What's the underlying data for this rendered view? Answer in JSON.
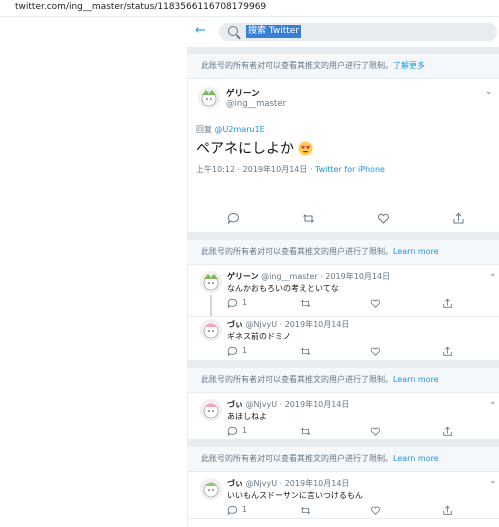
{
  "browser": {
    "url": "twitter.com/ing__master/status/1183566116708179969"
  },
  "header": {
    "search_placeholder": "搜索 Twitter"
  },
  "notice_top": {
    "text": "此账号的所有者对可以查看其推文的用户进行了限制。",
    "link": "了解更多"
  },
  "focus_tweet": {
    "name": "ゲリーン",
    "handle": "@ing__master",
    "reply_prefix": "回复",
    "reply_to": "@U2maru1E",
    "text": "ペアネにしよか",
    "emoji": "😍",
    "timestamp": "上午10:12 · 2019年10月14日 · ",
    "source": "Twitter for iPhone"
  },
  "notice": {
    "text": "此账号的所有者对可以查看其推文的用户进行了限制。",
    "link": "Learn more"
  },
  "tweets": [
    {
      "name": "ゲリーン",
      "handle": "@ing__master",
      "date": " · 2019年10月14日",
      "text": "なんかおもろいの考えといてな",
      "reply_count": "1"
    },
    {
      "name": "づぃ",
      "handle": "@NjvyU",
      "date": " · 2019年10月14日",
      "text": "ギネス前のドミノ",
      "reply_count": "1"
    },
    {
      "name": "づぃ",
      "handle": "@NjvyU",
      "date": " · 2019年10月14日",
      "text": "あほしねよ",
      "reply_count": "1"
    },
    {
      "name": "づぃ",
      "handle": "@NjvyU",
      "date": " · 2019年10月14日",
      "text": "いいもんスドーサンに言いつけるもん",
      "reply_count": "1"
    }
  ],
  "colors": {
    "link": "#1b95e0",
    "muted": "#657786",
    "accent": "#1da1f2",
    "divider": "#e6ecf0"
  }
}
